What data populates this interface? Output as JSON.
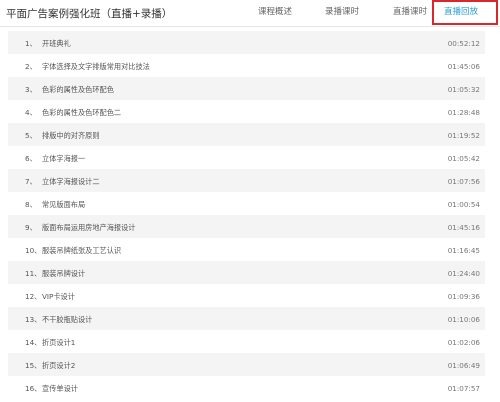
{
  "header": {
    "title": "平面广告案例强化班（直播+录播）",
    "tabs": [
      {
        "label": "课程概述"
      },
      {
        "label": "录播课时"
      },
      {
        "label": "直播课时"
      },
      {
        "label": "直播回放"
      }
    ],
    "active_tab": "直播回放",
    "accent_color": "#2a9fd6",
    "highlight_color": "#d8282d"
  },
  "lessons": [
    {
      "num": "1、",
      "title": "开班典礼",
      "duration": "00:52:12"
    },
    {
      "num": "2、",
      "title": "字体选择及文字排版常用对比技法",
      "duration": "01:45:06"
    },
    {
      "num": "3、",
      "title": "色彩的属性及色环配色",
      "duration": "01:05:32"
    },
    {
      "num": "4、",
      "title": "色彩的属性及色环配色二",
      "duration": "01:28:48"
    },
    {
      "num": "5、",
      "title": "排版中的对齐原则",
      "duration": "01:19:52"
    },
    {
      "num": "6、",
      "title": "立体字海报一",
      "duration": "01:05:42"
    },
    {
      "num": "7、",
      "title": "立体字海报设计二",
      "duration": "01:07:56"
    },
    {
      "num": "8、",
      "title": "常见版面布局",
      "duration": "01:00:54"
    },
    {
      "num": "9、",
      "title": "版面布局运用房地产海报设计",
      "duration": "01:45:16"
    },
    {
      "num": "10、",
      "title": "服装吊牌纸张及工艺认识",
      "duration": "01:16:45"
    },
    {
      "num": "11、",
      "title": "服装吊牌设计",
      "duration": "01:24:40"
    },
    {
      "num": "12、",
      "title": "VIP卡设计",
      "duration": "01:09:36"
    },
    {
      "num": "13、",
      "title": "不干胶瓶贴设计",
      "duration": "01:10:06"
    },
    {
      "num": "14、",
      "title": "折页设计1",
      "duration": "01:02:06"
    },
    {
      "num": "15、",
      "title": "折页设计2",
      "duration": "01:06:49"
    },
    {
      "num": "16、",
      "title": "宣传单设计",
      "duration": "01:07:57"
    }
  ]
}
